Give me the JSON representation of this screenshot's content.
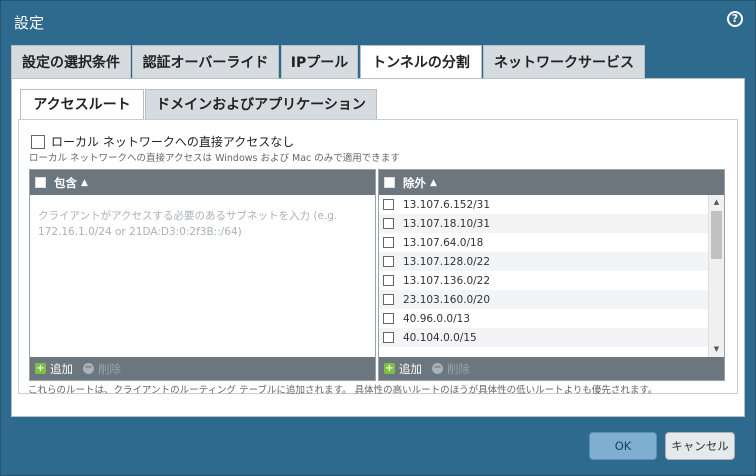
{
  "dialog": {
    "title": "設定",
    "help_icon": "help-circle-icon"
  },
  "tabs": [
    {
      "label": "設定の選択条件",
      "active": false
    },
    {
      "label": "認証オーバーライド",
      "active": false
    },
    {
      "label": "IPプール",
      "active": false
    },
    {
      "label": "トンネルの分割",
      "active": true
    },
    {
      "label": "ネットワークサービス",
      "active": false
    }
  ],
  "subtabs": [
    {
      "label": "アクセスルート",
      "active": true
    },
    {
      "label": "ドメインおよびアプリケーション",
      "active": false
    }
  ],
  "no_direct_access": {
    "label": "ローカル ネットワークへの直接アクセスなし",
    "checked": false,
    "note": "ローカル ネットワークへの直接アクセスは Windows および Mac のみで適用できます"
  },
  "include": {
    "header": "包含",
    "placeholder": "クライアントがアクセスする必要のあるサブネットを入力 (e.g. 172.16.1.0/24 or 21DA:D3:0:2f3B::/64)",
    "add_label": "追加",
    "delete_label": "削除"
  },
  "exclude": {
    "header": "除外",
    "rows": [
      "13.107.6.152/31",
      "13.107.18.10/31",
      "13.107.64.0/18",
      "13.107.128.0/22",
      "13.107.136.0/22",
      "23.103.160.0/20",
      "40.96.0.0/13",
      "40.104.0.0/15"
    ],
    "add_label": "追加",
    "delete_label": "削除"
  },
  "footer_note": "これらのルートは、クライアントのルーティング テーブルに追加されます。 具体性の高いルートのほうが具体性の低いルートよりも優先されます。",
  "buttons": {
    "ok": "OK",
    "cancel": "キャンセル"
  }
}
